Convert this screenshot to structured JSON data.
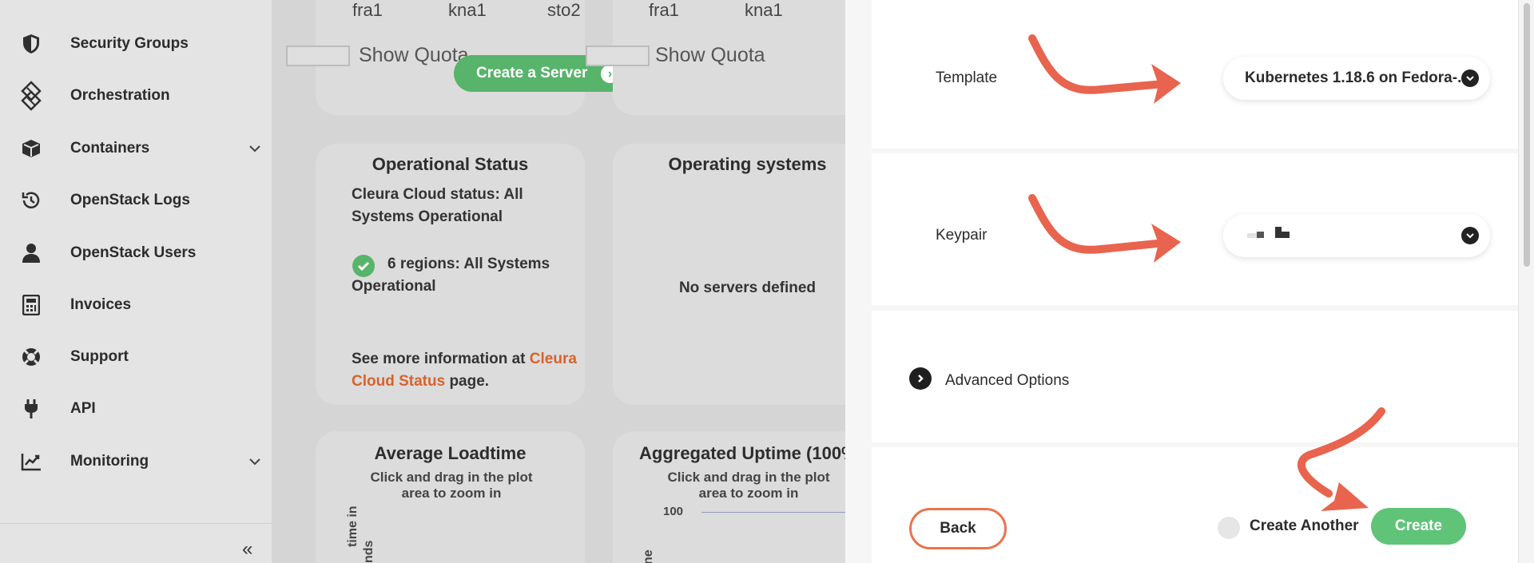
{
  "sidebar": {
    "items": [
      {
        "label": "Security Groups",
        "icon": "shield-icon"
      },
      {
        "label": "Orchestration",
        "icon": "orchestration-icon"
      },
      {
        "label": "Containers",
        "icon": "box-icon",
        "expandable": true
      },
      {
        "label": "OpenStack Logs",
        "icon": "history-icon"
      },
      {
        "label": "OpenStack Users",
        "icon": "user-icon"
      },
      {
        "label": "Invoices",
        "icon": "calculator-icon"
      },
      {
        "label": "Support",
        "icon": "lifebuoy-icon"
      },
      {
        "label": "API",
        "icon": "plug-icon"
      },
      {
        "label": "Monitoring",
        "icon": "chart-icon",
        "expandable": true
      }
    ],
    "collapse_glyph": "«"
  },
  "dashboard": {
    "card1": {
      "regions": [
        "fra1",
        "kna1",
        "sto2"
      ],
      "show_quota": "Show Quota",
      "create_server": "Create a Server"
    },
    "card2": {
      "regions": [
        "fra1",
        "kna1"
      ],
      "show_quota": "Show Quota"
    },
    "operational_status": {
      "title": "Operational Status",
      "status_line": "Cleura Cloud status: All Systems Operational",
      "regions_line": "6 regions: All Systems Operational",
      "more_prefix": "See more information at ",
      "more_link": "Cleura Cloud Status",
      "more_suffix": " page."
    },
    "operating_systems": {
      "title": "Operating systems",
      "empty": "No servers defined"
    },
    "average_loadtime": {
      "title": "Average Loadtime",
      "hint": "Click and drag in the plot area to zoom in",
      "ylabel_fragment": "time in",
      "ylabel_fragment2": "nds"
    },
    "aggregated_uptime": {
      "title": "Aggregated Uptime (100%",
      "hint": "Click and drag in the plot area to zoom in",
      "y_tick": "100",
      "ylabel_fragment": "ne"
    }
  },
  "modal": {
    "template_label": "Template",
    "template_value": "Kubernetes 1.18.6 on Fedora-...",
    "keypair_label": "Keypair",
    "keypair_value": "",
    "advanced_label": "Advanced Options",
    "back_label": "Back",
    "create_another_label": "Create Another",
    "create_label": "Create"
  },
  "colors": {
    "accent_green": "#57b46a",
    "link_orange": "#d9622b",
    "arrow_red": "#e8644e"
  }
}
